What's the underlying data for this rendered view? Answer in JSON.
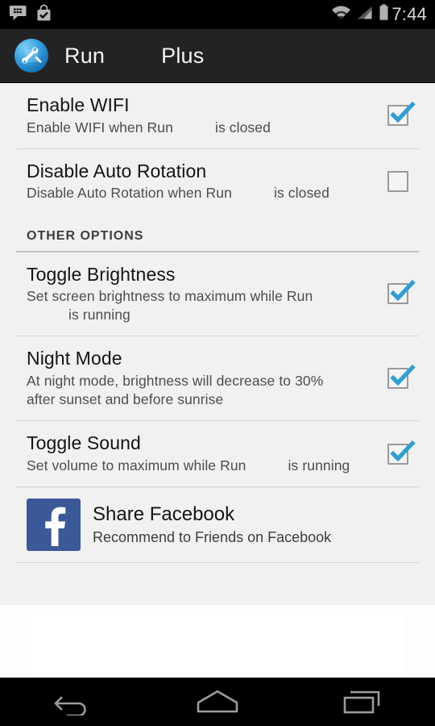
{
  "status_bar": {
    "time": "7:44",
    "left_icons": [
      "bbm-message-icon",
      "play-store-installed-icon"
    ],
    "right_icons": [
      "wifi-icon",
      "cellular-signal-icon",
      "battery-icon"
    ]
  },
  "action_bar": {
    "app_icon": "tools-app-icon",
    "title": "Run",
    "title_suffix": "Plus"
  },
  "preferences": [
    {
      "title": "Enable WIFI",
      "summary_start": "Enable WIFI when Run",
      "summary_end": "is closed",
      "checked": true,
      "name": "enable-wifi"
    },
    {
      "title": "Disable Auto Rotation",
      "summary_start": "Disable Auto Rotation when Run",
      "summary_end": "is closed",
      "checked": false,
      "name": "disable-auto-rotation"
    }
  ],
  "section": {
    "header": "OTHER OPTIONS",
    "preferences": [
      {
        "title": "Toggle Brightness",
        "summary_start": "Set screen brightness to maximum while Run",
        "summary_end": "is running",
        "checked": true,
        "name": "toggle-brightness"
      },
      {
        "title": "Night Mode",
        "summary_start": "At night mode, brightness will decrease to 30% after sunset and before sunrise",
        "summary_end": "",
        "checked": true,
        "name": "night-mode"
      },
      {
        "title": "Toggle Sound",
        "summary_start": "Set volume to maximum while Run",
        "summary_end": "is running",
        "checked": true,
        "name": "toggle-sound"
      }
    ]
  },
  "share": {
    "icon": "facebook-icon",
    "title": "Share Facebook",
    "summary": "Recommend to Friends on Facebook",
    "brand_color": "#3b5998"
  },
  "nav_bar": {
    "back": "back-icon",
    "home": "home-icon",
    "recents": "recent-apps-icon"
  },
  "colors": {
    "accent": "#33b5e5",
    "action_bar": "#232323",
    "list_background": "#f1f1f1"
  }
}
